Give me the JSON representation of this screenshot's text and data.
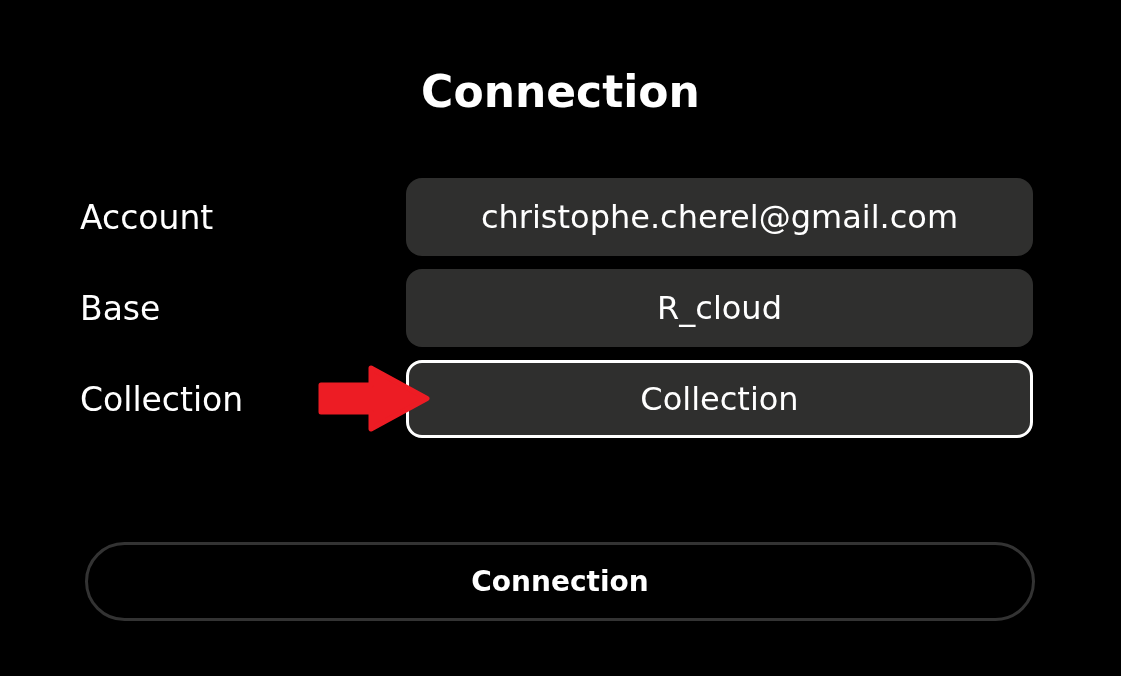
{
  "title": "Connection",
  "fields": [
    {
      "label": "Account",
      "value": "christophe.cherel@gmail.com",
      "focused": false,
      "marked": false
    },
    {
      "label": "Base",
      "value": "R_cloud",
      "focused": false,
      "marked": false
    },
    {
      "label": "Collection",
      "value": "Collection",
      "focused": true,
      "marked": true
    }
  ],
  "button": {
    "label": "Connection"
  }
}
